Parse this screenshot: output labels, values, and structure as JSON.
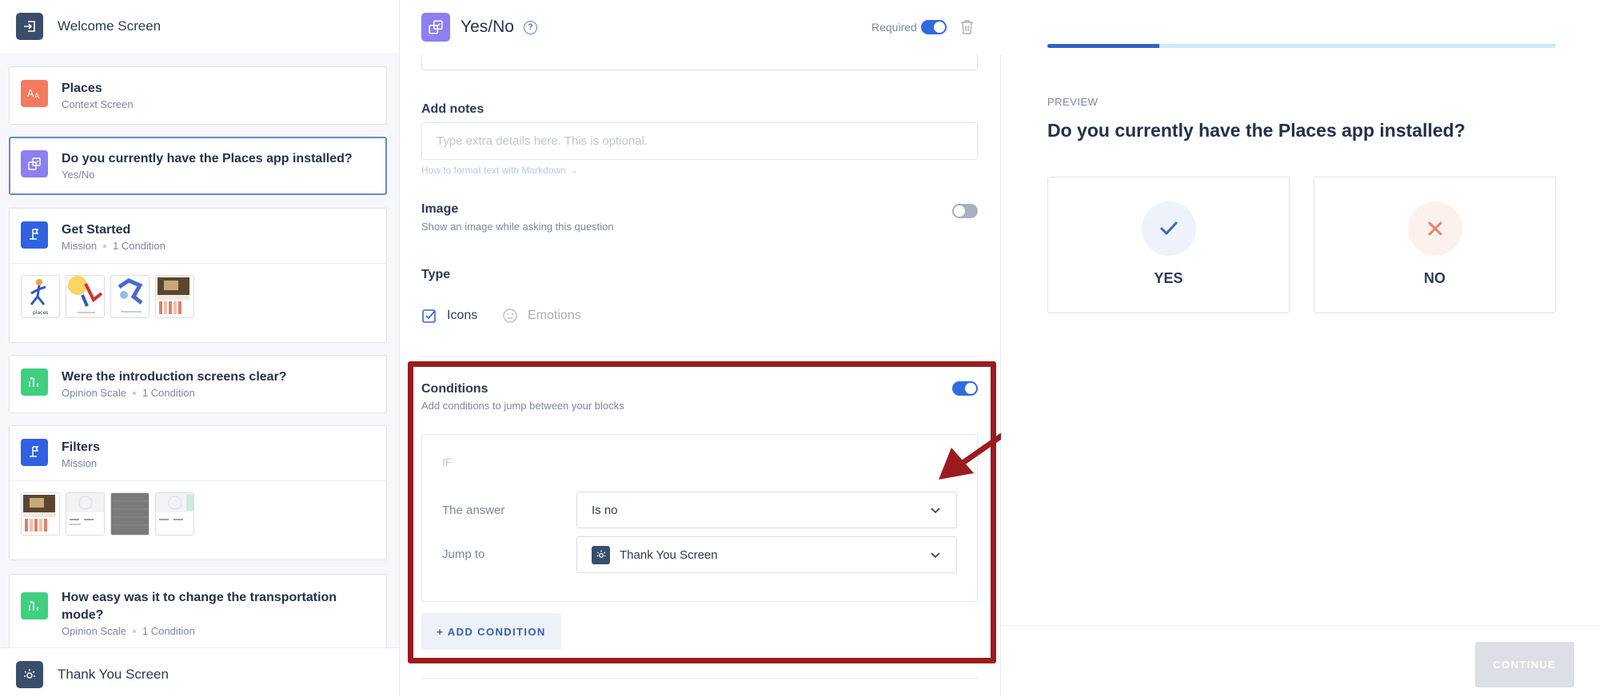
{
  "sidebar": {
    "welcome_label": "Welcome Screen",
    "thankyou_label": "Thank You Screen",
    "blocks": [
      {
        "title": "Places",
        "subtitle": "Context Screen",
        "color": "#f37a5f"
      },
      {
        "title": "Do you currently have the Places app installed?",
        "subtitle": "Yes/No",
        "color": "#8c7ff0"
      },
      {
        "title": "Get Started",
        "subtitle": "Mission",
        "meta": "1 Condition",
        "color": "#2f62e0",
        "thumb_texts": [
          "places",
          "",
          "",
          ""
        ]
      },
      {
        "title": "Were the introduction screens clear?",
        "subtitle": "Opinion Scale",
        "meta": "1 Condition",
        "color": "#3fcf7f"
      },
      {
        "title": "Filters",
        "subtitle": "Mission",
        "color": "#2f62e0"
      },
      {
        "title_line1": "How easy was it to change the transportation",
        "title_line2": "mode?",
        "subtitle": "Opinion Scale",
        "meta": "1 Condition",
        "color": "#3fcf7f"
      }
    ]
  },
  "editor": {
    "block_type": "Yes/No",
    "required_label": "Required",
    "required_on": true,
    "add_notes_label": "Add notes",
    "notes_placeholder": "Type extra details here. This is optional.",
    "markdown_link": "How to format text with Markdown →",
    "image_label": "Image",
    "image_sub": "Show an image while asking this question",
    "image_on": false,
    "type_label": "Type",
    "type_options": [
      "Icons",
      "Emotions"
    ],
    "type_selected": "Icons",
    "conditions_label": "Conditions",
    "conditions_sub": "Add conditions to jump between your blocks",
    "conditions_on": true,
    "if_label": "IF",
    "answer_label": "The answer",
    "answer_value": "Is no",
    "jump_label": "Jump to",
    "jump_value": "Thank You Screen",
    "add_condition_label": "+ ADD CONDITION"
  },
  "preview": {
    "label": "PREVIEW",
    "question": "Do you currently have the Places app installed?",
    "progress_fraction": 0.22,
    "yes_label": "YES",
    "no_label": "NO",
    "continue_label": "CONTINUE"
  },
  "colors": {
    "accent": "#2f6be0",
    "highlight": "#9b1c1f",
    "yes_check": "#3a64c8",
    "no_cross": "#e8826b"
  }
}
